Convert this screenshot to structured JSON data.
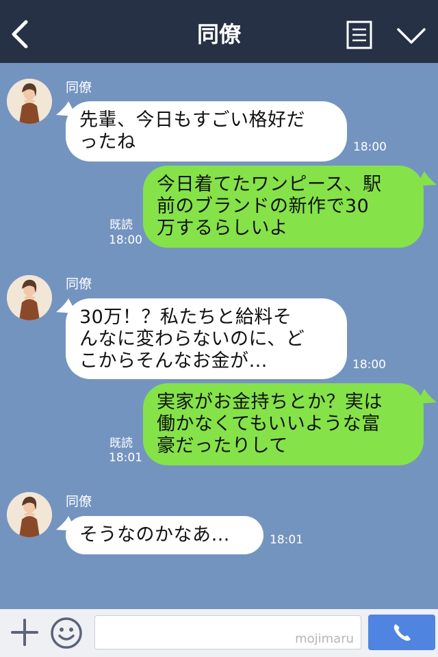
{
  "header": {
    "title": "同僚",
    "back_icon": "chevron-left-icon",
    "menu_icon": "notes-menu-icon",
    "dropdown_icon": "chevron-down-icon",
    "background": "#263146"
  },
  "chat": {
    "background": "#7494c0",
    "messages": [
      {
        "side": "received",
        "sender": "同僚",
        "text": "先輩、今日もすごい格好だ\nったね",
        "time": "18:00"
      },
      {
        "side": "sent",
        "read": "既読",
        "text": "今日着てたワンピース、駅\n前のブランドの新作で30\n万するらしいよ",
        "time": "18:00"
      },
      {
        "side": "received",
        "sender": "同僚",
        "text": "30万！？私たちと給料そ\nんなに変わらないのに、ど\nこからそんなお金が…",
        "time": "18:00"
      },
      {
        "side": "sent",
        "read": "既読",
        "text": "実家がお金持ちとか？実は\n働かなくてもいいような富\n豪だったりして",
        "time": "18:01"
      },
      {
        "side": "received",
        "sender": "同僚",
        "text": "そうなのかなあ…",
        "time": "18:01"
      }
    ]
  },
  "input_bar": {
    "plus_icon": "plus-icon",
    "emoji_icon": "smiley-icon",
    "watermark": "mojimaru",
    "call_icon": "phone-icon",
    "call_color": "#4f84e0"
  },
  "colors": {
    "sent_bubble": "#85e249",
    "received_bubble": "#ffffff"
  }
}
